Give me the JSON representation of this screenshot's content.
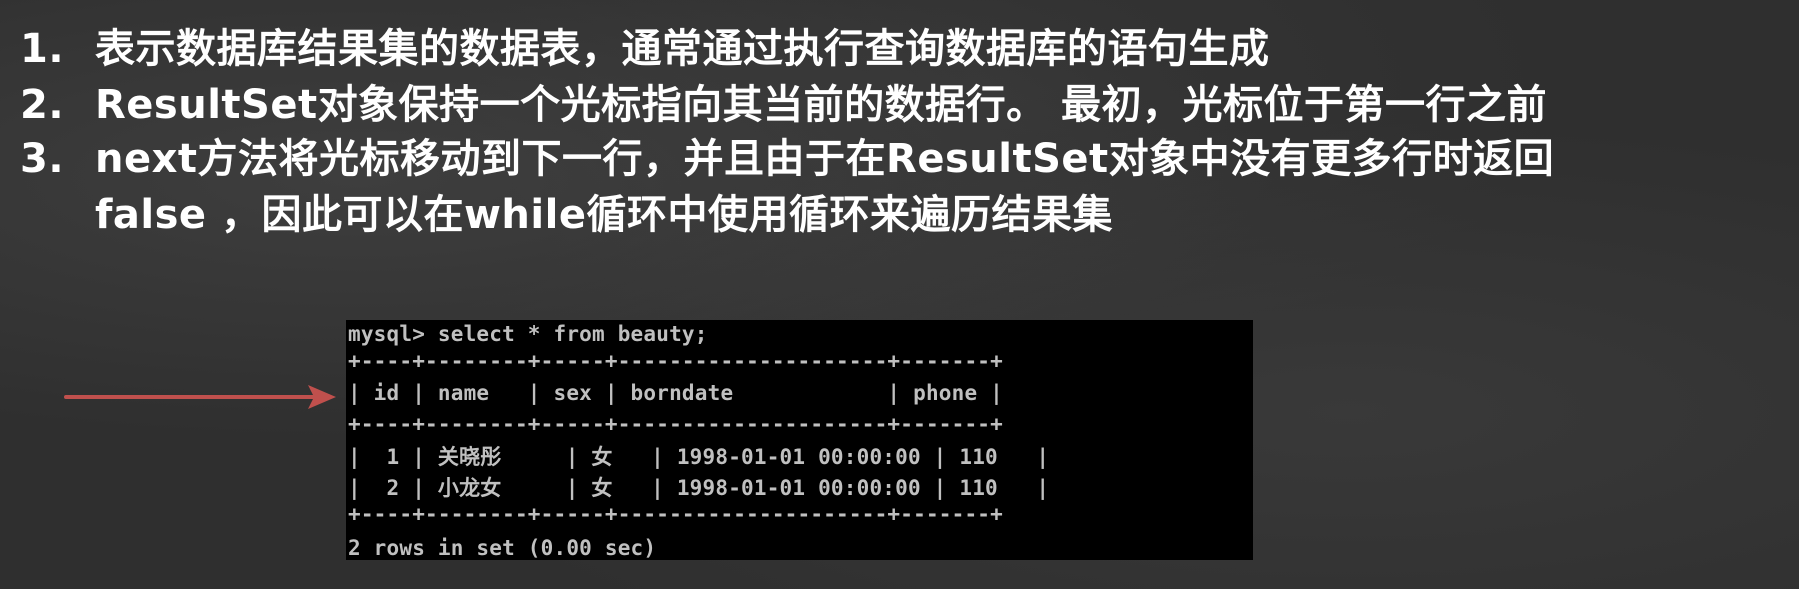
{
  "slide": {
    "points": [
      {
        "num": "1.",
        "text": "表示数据库结果集的数据表，通常通过执行查询数据库的语句生成"
      },
      {
        "num": "2.",
        "text": "ResultSet对象保持一个光标指向其当前的数据行。 最初，光标位于第一行之前"
      },
      {
        "num": "3.",
        "text": "next方法将光标移动到下一行，并且由于在ResultSet对象中没有更多行时返回"
      },
      {
        "num": "",
        "text": "false ，因此可以在while循环中使用循环来遍历结果集"
      }
    ]
  },
  "console": {
    "command": "mysql> select * from beauty;",
    "border": "+----+--------+-----+---------------------+-------+",
    "header": "| id | name   | sex | borndate            | phone |",
    "rows": [
      "|  1 | 关晓彤     | 女   | 1998-01-01 00:00:00 | 110   |",
      "|  2 | 小龙女     | 女   | 1998-01-01 00:00:00 | 110   |"
    ],
    "footer": "2 rows in set (0.00 sec)"
  },
  "colors": {
    "background": "#2f2f2f",
    "text": "#ffffff",
    "console_bg": "#000000",
    "console_text": "#c0c0c0",
    "arrow": "#c0504d"
  },
  "icons": {
    "arrow": "right-arrow-icon"
  }
}
